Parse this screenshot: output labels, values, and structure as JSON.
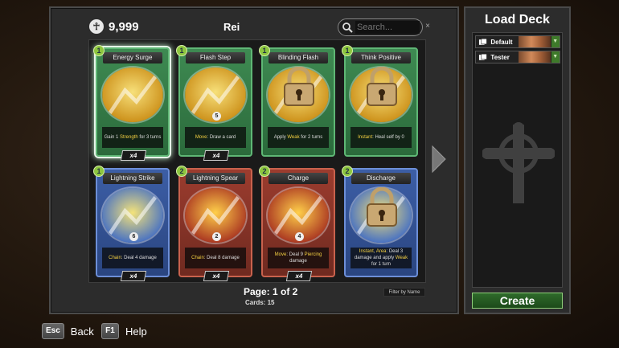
{
  "currency": {
    "value": "9,999",
    "icon": "coin-icon"
  },
  "deck_owner": "Rei",
  "search": {
    "placeholder": "Search...",
    "value": ""
  },
  "cards": [
    {
      "name": "Energy Surge",
      "cost": "1",
      "color": "green",
      "selected": true,
      "locked": false,
      "art_number": "",
      "desc_parts": [
        "Gain 1 ",
        "Strength",
        " for 3 turns"
      ],
      "count": "x4"
    },
    {
      "name": "Flash Step",
      "cost": "1",
      "color": "green",
      "selected": false,
      "locked": false,
      "art_number": "5",
      "desc_parts": [
        "",
        "Move",
        ": Draw a card"
      ],
      "count": "x4"
    },
    {
      "name": "Blinding Flash",
      "cost": "1",
      "color": "green",
      "selected": false,
      "locked": true,
      "art_number": "",
      "desc_parts": [
        "Apply ",
        "Weak",
        " for 2 turns"
      ],
      "count": ""
    },
    {
      "name": "Think Positive",
      "cost": "1",
      "color": "green",
      "selected": false,
      "locked": true,
      "art_number": "",
      "desc_parts": [
        "",
        "Instant",
        ": Heal self by 0"
      ],
      "count": ""
    },
    {
      "name": "Lightning Strike",
      "cost": "1",
      "color": "blue",
      "selected": false,
      "locked": false,
      "art_number": "6",
      "desc_parts": [
        "",
        "Chain",
        ": Deal 4 damage"
      ],
      "count": "x4"
    },
    {
      "name": "Lightning Spear",
      "cost": "2",
      "color": "red",
      "selected": false,
      "locked": false,
      "art_number": "2",
      "desc_parts": [
        "",
        "Chain",
        ": Deal 8 damage"
      ],
      "count": "x4"
    },
    {
      "name": "Charge",
      "cost": "2",
      "color": "red",
      "selected": false,
      "locked": false,
      "art_number": "4",
      "desc_parts": [
        "",
        "Move",
        ": Deal 9 ",
        "Piercing",
        " damage"
      ],
      "count": "x4"
    },
    {
      "name": "Discharge",
      "cost": "2",
      "color": "blue",
      "selected": false,
      "locked": true,
      "art_number": "",
      "desc_parts": [
        "",
        "Instant",
        ", ",
        "Area",
        ": Deal 3 damage and apply ",
        "Weak",
        " for 1 turn"
      ],
      "count": ""
    }
  ],
  "pagination": {
    "page_label": "Page: 1 of 2",
    "cards_label": "Cards: 15"
  },
  "filter_label": "Filter by Name",
  "deck_panel": {
    "title": "Load Deck",
    "decks": [
      {
        "name": "Default"
      },
      {
        "name": "Tester"
      }
    ],
    "create_label": "Create"
  },
  "hints": [
    {
      "key": "Esc",
      "label": "Back"
    },
    {
      "key": "F1",
      "label": "Help"
    }
  ],
  "colors": {
    "green": "#3e8a52",
    "blue": "#3c5ea6",
    "red": "#9c3c2e",
    "keyword": "#f5d142",
    "create": "#2e6a2a"
  }
}
